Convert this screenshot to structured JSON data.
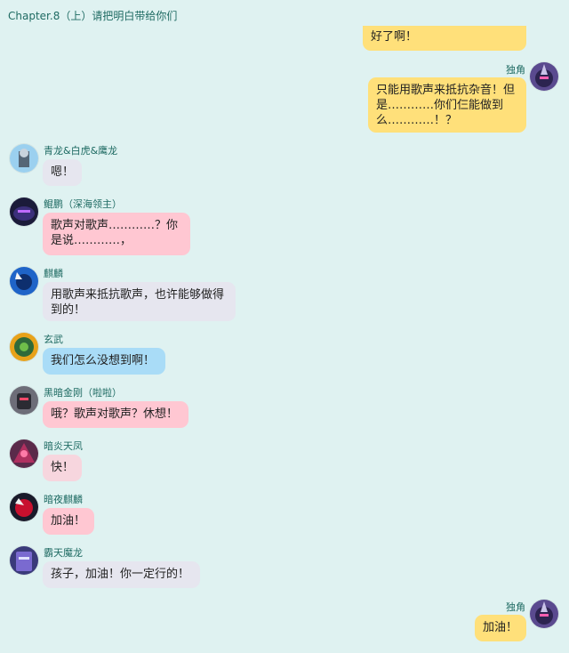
{
  "header": {
    "title": "Chapter.8（上）请把明白带给你们"
  },
  "messages": [
    {
      "side": "right",
      "name": "",
      "text": "好了啊！",
      "color": "yellow"
    },
    {
      "side": "right",
      "name": "独角",
      "text": "只能用歌声来抵抗杂音！但是…………你们仨能做到么…………！？",
      "color": "yellow"
    },
    {
      "side": "left",
      "name": "青龙&白虎&鹰龙",
      "text": "嗯！",
      "color": "gray"
    },
    {
      "side": "left",
      "name": "鲲鹏（深海领主）",
      "text": "歌声对歌声…………？你是说…………，",
      "color": "pink"
    },
    {
      "side": "left",
      "name": "麒麟",
      "text": "用歌声来抵抗歌声，也许能够做得到的！",
      "color": "gray"
    },
    {
      "side": "left",
      "name": "玄武",
      "text": "我们怎么没想到啊！",
      "color": "blue"
    },
    {
      "side": "left",
      "name": "黑暗金刚（啦啦）",
      "text": "哦？歌声对歌声？休想！",
      "color": "pink"
    },
    {
      "side": "left",
      "name": "暗炎天凤",
      "text": "快！",
      "color": "pink-light"
    },
    {
      "side": "left",
      "name": "暗夜麒麟",
      "text": "加油！",
      "color": "pink"
    },
    {
      "side": "left",
      "name": "霸天魔龙",
      "text": "孩子，加油！你一定行的！",
      "color": "gray"
    },
    {
      "side": "right",
      "name": "独角",
      "text": "加油！",
      "color": "yellow"
    }
  ],
  "colors": {
    "background": "#dff2f1",
    "yellow": "#ffe07a",
    "gray": "#e6e6ef",
    "pink": "#ffc7d2",
    "blue": "#a9dcf7",
    "name": "#1f6b63"
  }
}
